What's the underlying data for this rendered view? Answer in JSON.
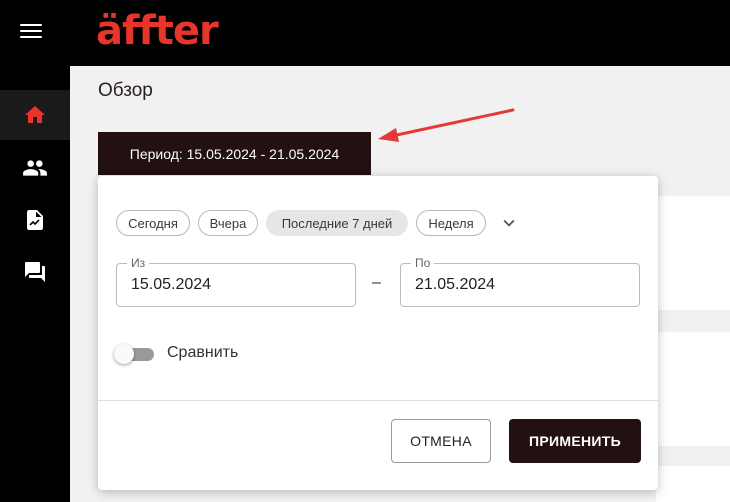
{
  "app": {
    "logo_text": "äffter",
    "brand_color": "#e8352b",
    "dark_color": "#231011"
  },
  "sidebar": {
    "items": [
      {
        "icon": "home-icon",
        "active": true
      },
      {
        "icon": "users-icon",
        "active": false
      },
      {
        "icon": "report-icon",
        "active": false
      },
      {
        "icon": "chat-icon",
        "active": false
      }
    ]
  },
  "page": {
    "title": "Обзор"
  },
  "period": {
    "label": "Период: 15.05.2024 - 21.05.2024"
  },
  "dialog": {
    "presets": [
      {
        "label": "Сегодня",
        "selected": false
      },
      {
        "label": "Вчера",
        "selected": false
      },
      {
        "label": "Последние 7 дней",
        "selected": true
      },
      {
        "label": "Неделя",
        "selected": false
      }
    ],
    "from": {
      "label": "Из",
      "value": "15.05.2024"
    },
    "separator": "–",
    "to": {
      "label": "По",
      "value": "21.05.2024"
    },
    "compare": {
      "label": "Сравнить",
      "checked": false
    },
    "cancel_label": "ОТМЕНА",
    "apply_label": "ПРИМЕНИТЬ"
  }
}
